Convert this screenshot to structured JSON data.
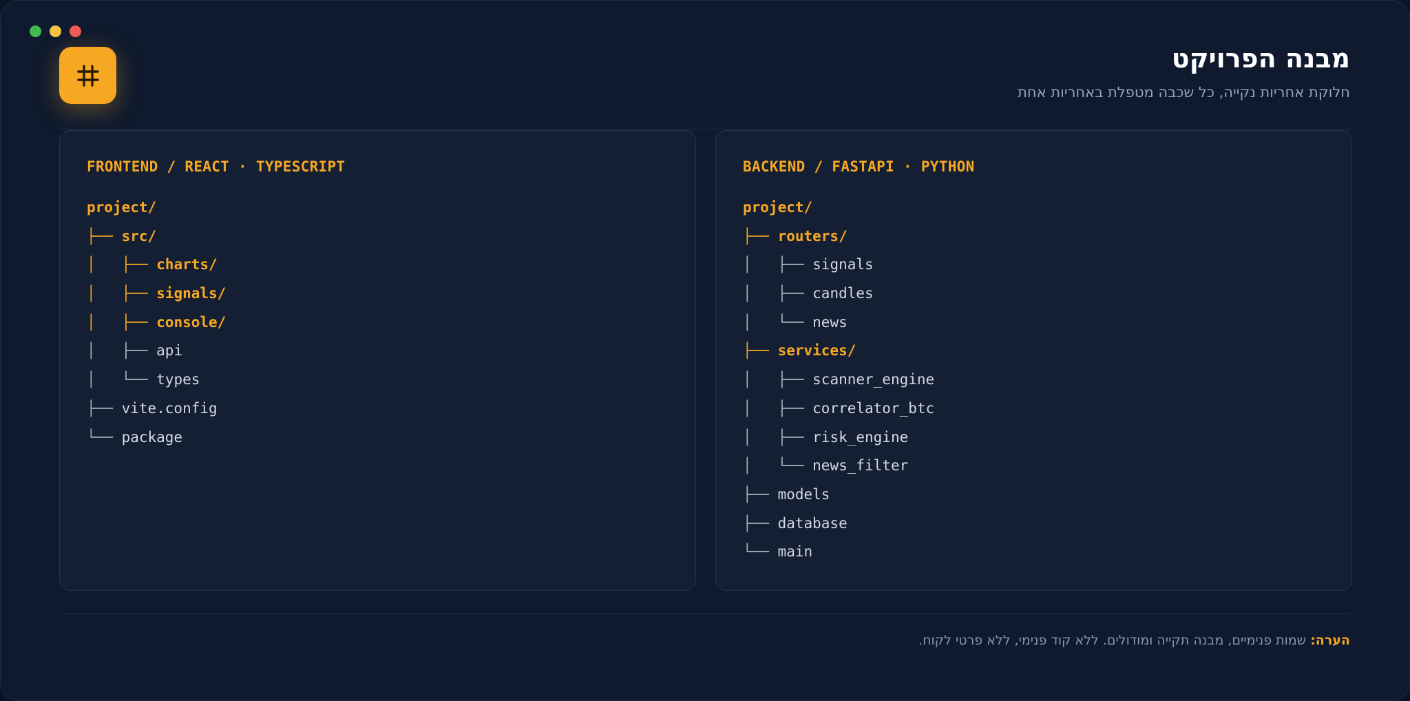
{
  "window": {
    "dots": [
      "green",
      "yellow",
      "red"
    ]
  },
  "header": {
    "logo_icon": "hash-icon",
    "title": "מבנה הפרויקט",
    "subtitle": "חלוקת אחריות נקייה, כל שכבה מטפלת באחריות אחת"
  },
  "colors": {
    "accent": "#f7a823",
    "background": "#0f1a2e",
    "panel": "#141f33",
    "text": "#d3d9e3",
    "muted": "#97a3b6"
  },
  "panels": {
    "frontend": {
      "title": "FRONTEND / REACT · TYPESCRIPT",
      "lines": [
        {
          "prefix": "",
          "name": "project/",
          "type": "root"
        },
        {
          "prefix": "├── ",
          "name": "src/",
          "type": "folder"
        },
        {
          "prefix": "│   ├── ",
          "name": "charts/",
          "type": "folder"
        },
        {
          "prefix": "│   ├── ",
          "name": "signals/",
          "type": "folder"
        },
        {
          "prefix": "│   ├── ",
          "name": "console/",
          "type": "folder"
        },
        {
          "prefix": "│   ├── ",
          "name": "api",
          "type": "file"
        },
        {
          "prefix": "│   └── ",
          "name": "types",
          "type": "file"
        },
        {
          "prefix": "├── ",
          "name": "vite.config",
          "type": "file"
        },
        {
          "prefix": "└── ",
          "name": "package",
          "type": "file"
        }
      ]
    },
    "backend": {
      "title": "BACKEND / FASTAPI · PYTHON",
      "lines": [
        {
          "prefix": "",
          "name": "project/",
          "type": "root"
        },
        {
          "prefix": "├── ",
          "name": "routers/",
          "type": "folder"
        },
        {
          "prefix": "│   ├── ",
          "name": "signals",
          "type": "file"
        },
        {
          "prefix": "│   ├── ",
          "name": "candles",
          "type": "file"
        },
        {
          "prefix": "│   └── ",
          "name": "news",
          "type": "file"
        },
        {
          "prefix": "├── ",
          "name": "services/",
          "type": "folder"
        },
        {
          "prefix": "│   ├── ",
          "name": "scanner_engine",
          "type": "file"
        },
        {
          "prefix": "│   ├── ",
          "name": "correlator_btc",
          "type": "file"
        },
        {
          "prefix": "│   ├── ",
          "name": "risk_engine",
          "type": "file"
        },
        {
          "prefix": "│   └── ",
          "name": "news_filter",
          "type": "file"
        },
        {
          "prefix": "├── ",
          "name": "models",
          "type": "file"
        },
        {
          "prefix": "├── ",
          "name": "database",
          "type": "file"
        },
        {
          "prefix": "└── ",
          "name": "main",
          "type": "file"
        }
      ]
    }
  },
  "footer": {
    "note_label": "הערה:",
    "note_text": " שמות פנימיים, מבנה תקייה ומודולים. ללא קוד פנימי, ללא פרטי לקוח."
  }
}
